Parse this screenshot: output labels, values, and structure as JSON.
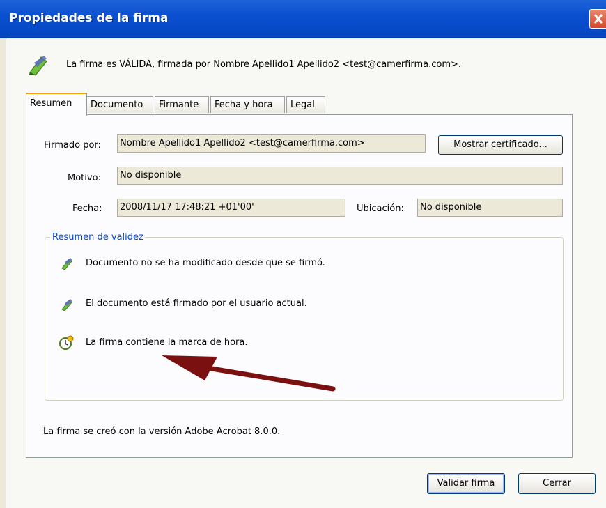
{
  "window": {
    "title": "Propiedades de la firma"
  },
  "header": {
    "message": "La firma es VÁLIDA, firmada por Nombre Apellido1 Apellido2 <test@camerfirma.com>."
  },
  "tabs": [
    {
      "label": "Resumen",
      "active": true
    },
    {
      "label": "Documento"
    },
    {
      "label": "Firmante"
    },
    {
      "label": "Fecha y hora"
    },
    {
      "label": "Legal"
    }
  ],
  "summary": {
    "signed_by_label": "Firmado por:",
    "signed_by_value": "Nombre Apellido1 Apellido2 <test@camerfirma.com>",
    "show_cert_button": "Mostrar certificado...",
    "reason_label": "Motivo:",
    "reason_value": "No disponible",
    "date_label": "Fecha:",
    "date_value": "2008/11/17 17:48:21 +01'00'",
    "location_label": "Ubicación:",
    "location_value": "No disponible"
  },
  "validity": {
    "title": "Resumen de validez",
    "items": [
      {
        "text": "Documento no se ha modificado desde que se firmó.",
        "icon": "pen-icon"
      },
      {
        "text": "El documento está firmado por el usuario actual.",
        "icon": "pen-icon"
      },
      {
        "text": "La firma contiene la marca de hora.",
        "icon": "clock-icon"
      }
    ]
  },
  "footer_note": "La firma se creó con la versión Adobe Acrobat 8.0.0.",
  "buttons": {
    "validate": "Validar firma",
    "close": "Cerrar"
  },
  "colors": {
    "title_bar": "#0a50d0",
    "group_title": "#0046d5",
    "arrow": "#7a1010"
  }
}
